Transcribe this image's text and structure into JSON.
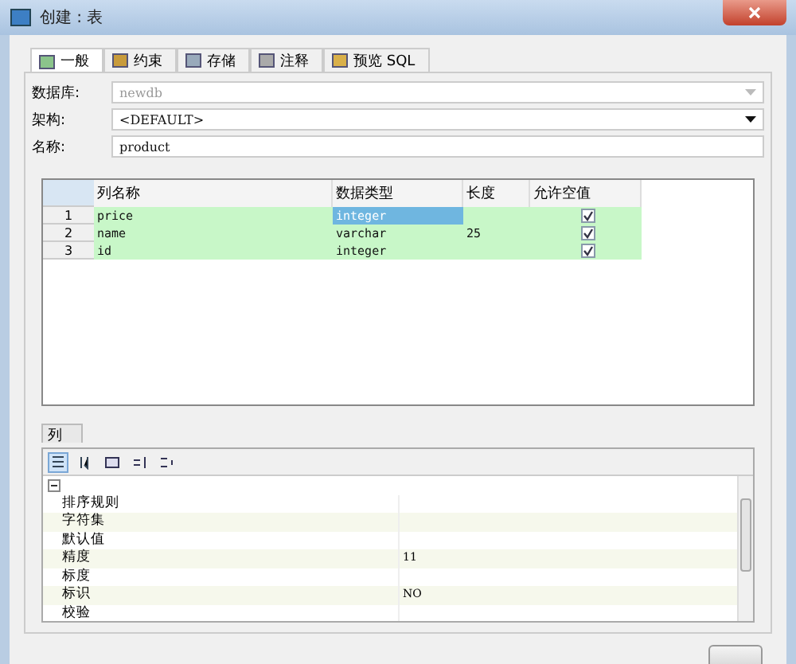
{
  "window": {
    "title": "创建 : 表"
  },
  "tabs": [
    {
      "label": "一般",
      "selected": true
    },
    {
      "label": "约束",
      "selected": false
    },
    {
      "label": "存储",
      "selected": false
    },
    {
      "label": "注释",
      "selected": false
    },
    {
      "label": "预览 SQL",
      "selected": false
    }
  ],
  "form": [
    {
      "label": "数据库:",
      "value": "newdb",
      "disabled": true
    },
    {
      "label": "架构:",
      "value": "<DEFAULT>",
      "disabled": false
    },
    {
      "label": "名称:",
      "value": "product",
      "kind": "text"
    }
  ],
  "table": {
    "columns": [
      "列名称",
      "数据类型",
      "长度",
      "允许空值"
    ],
    "rows": [
      {
        "index": "1",
        "name": "price",
        "type": "integer",
        "nullable": true,
        "selected": true
      },
      {
        "index": "2",
        "name": "name",
        "type": "varchar",
        "length": "25",
        "nullable": true,
        "selected": false
      },
      {
        "index": "3",
        "name": "id",
        "type": "integer",
        "nullable": true,
        "selected": false
      }
    ]
  },
  "bottom_tab": {
    "label": "列"
  },
  "properties": [
    {
      "name": "排序规则"
    },
    {
      "name": "字符集"
    },
    {
      "name": "默认值"
    },
    {
      "name": "精度",
      "value": "11"
    },
    {
      "name": "标度"
    },
    {
      "name": "标识",
      "value": "NO"
    },
    {
      "name": "校验"
    }
  ]
}
